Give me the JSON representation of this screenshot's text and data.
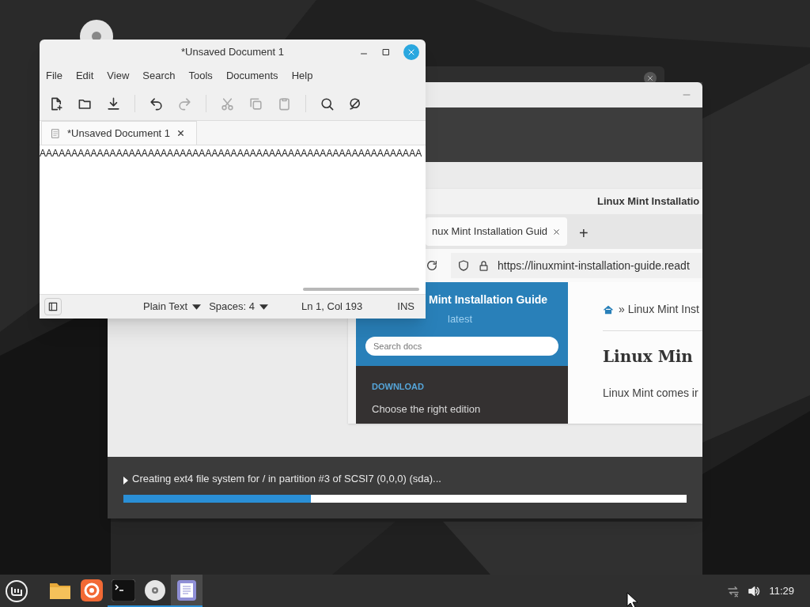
{
  "editor": {
    "title": "*Unsaved Document 1",
    "menu": [
      "File",
      "Edit",
      "View",
      "Search",
      "Tools",
      "Documents",
      "Help"
    ],
    "tab": {
      "label": "*Unsaved Document 1",
      "selected": true
    },
    "text": "AAAAAAAAAAAAAAAAAAAAAAAAAAAAAAAAAAAAAAAAAAAAAAAAAAAAAAAAAAAA",
    "status": {
      "language": "Plain Text",
      "spaces": "Spaces: 4",
      "position": "Ln 1, Col 193",
      "mode": "INS"
    }
  },
  "installer": {
    "slide": {
      "window_title": "Linux Mint Installatio",
      "tab": {
        "label": "nux Mint Installation Guid",
        "selected": true
      },
      "new_tab": "+",
      "url": "https://linuxmint-installation-guide.readt",
      "sidebar": {
        "title": "Mint Installation Guide",
        "version": "latest",
        "search_placeholder": "Search docs",
        "section": "DOWNLOAD",
        "items": [
          "Choose the right edition"
        ]
      },
      "breadcrumb": "» Linux Mint Inst",
      "heading": "Linux Min",
      "paragraph": "Linux Mint comes ir"
    },
    "progress": {
      "message": "Creating ext4 file system for / in partition #3 of SCSI7 (0,0,0) (sda)...",
      "level": 0.333
    }
  },
  "taskbar": {
    "apps": [
      {
        "kind": "files",
        "running": false,
        "active": false
      },
      {
        "kind": "browser",
        "running": false,
        "active": false
      },
      {
        "kind": "terminal",
        "running": true,
        "active": false
      },
      {
        "kind": "disc",
        "running": true,
        "active": false
      },
      {
        "kind": "editor",
        "running": true,
        "active": true
      }
    ],
    "clock": "11:29"
  }
}
